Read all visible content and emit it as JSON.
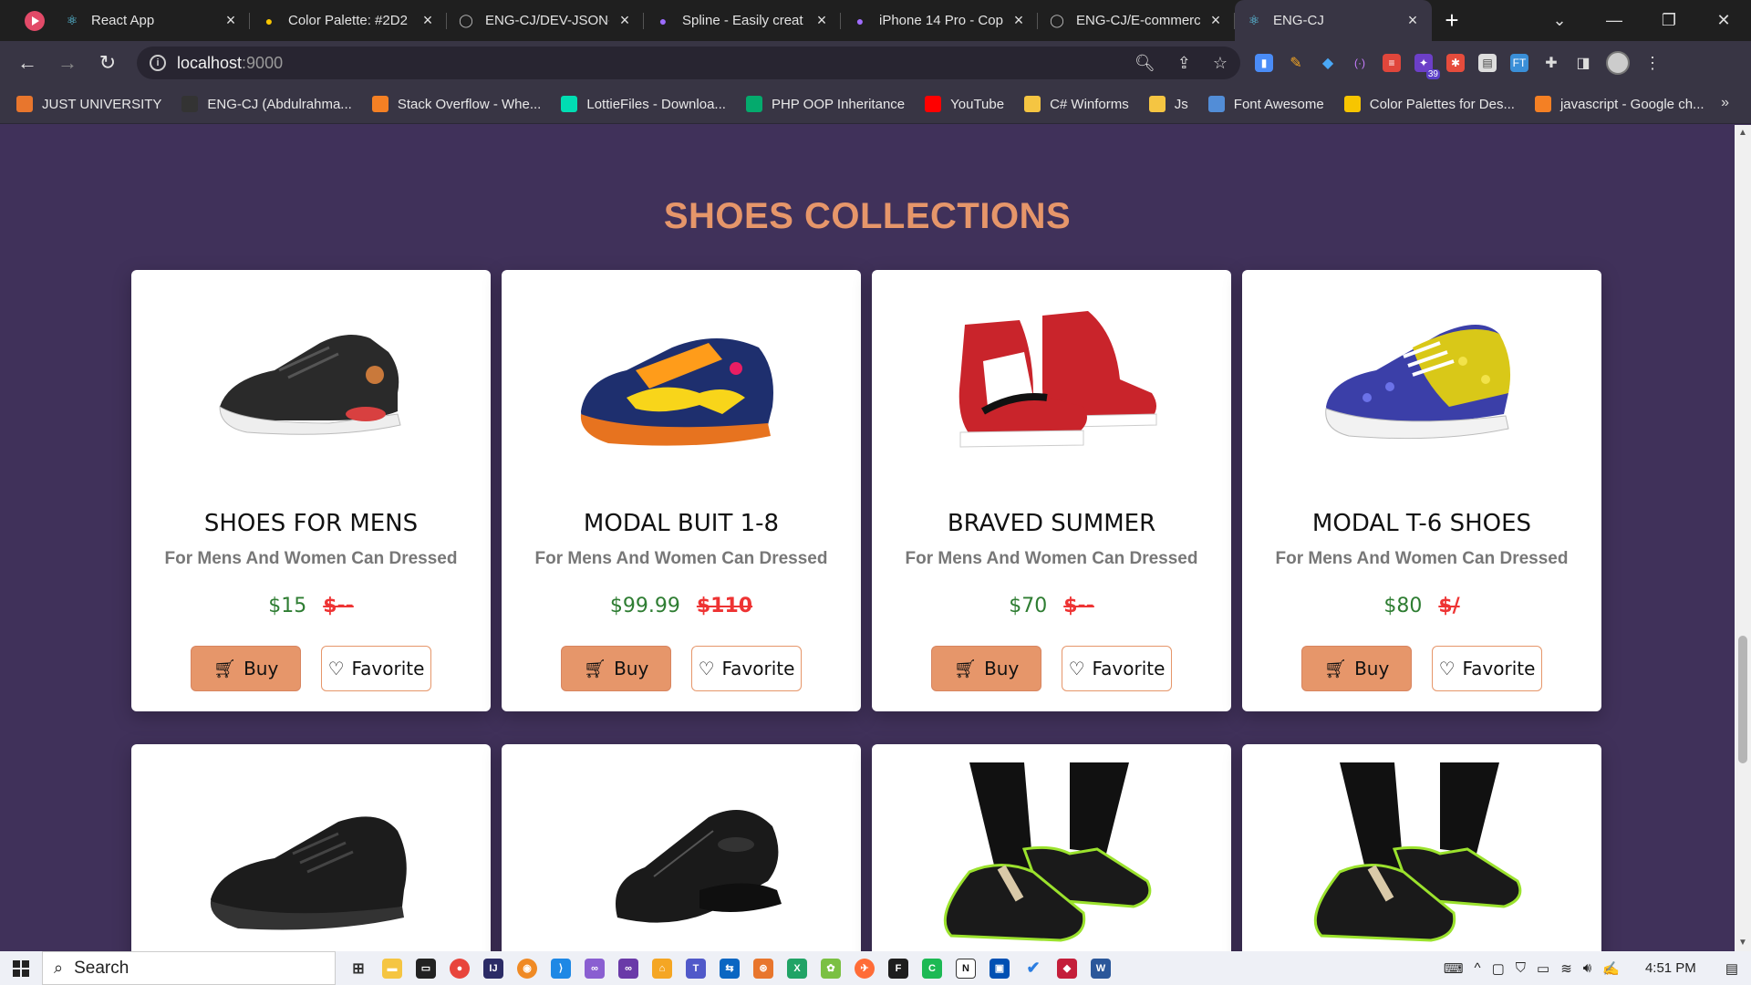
{
  "browser": {
    "tabs": [
      {
        "title": "React App",
        "favicon": "react-icon",
        "color": "#61dafb",
        "active": false
      },
      {
        "title": "Color Palette: #2D2",
        "favicon": "palette-icon",
        "color": "#f7c500",
        "active": false
      },
      {
        "title": "ENG-CJ/DEV-JSON-",
        "favicon": "github-icon",
        "color": "#bbbbbb",
        "active": false
      },
      {
        "title": "Spline - Easily creat",
        "favicon": "spline-icon",
        "color": "#9c6cff",
        "active": false
      },
      {
        "title": "iPhone 14 Pro - Cop",
        "favicon": "figma-icon",
        "color": "#a06cff",
        "active": false
      },
      {
        "title": "ENG-CJ/E-commerc",
        "favicon": "github-icon",
        "color": "#bbbbbb",
        "active": false
      },
      {
        "title": "ENG-CJ",
        "favicon": "react-icon",
        "color": "#61dafb",
        "active": true
      }
    ],
    "address": {
      "host": "localhost",
      "port": ":9000"
    },
    "bookmarks": [
      {
        "label": "JUST UNIVERSITY",
        "color": "#e8762d"
      },
      {
        "label": "ENG-CJ (Abdulrahma...",
        "color": "#333333"
      },
      {
        "label": "Stack Overflow - Whe...",
        "color": "#f48024"
      },
      {
        "label": "LottieFiles - Downloa...",
        "color": "#00ddb3"
      },
      {
        "label": "PHP OOP Inheritance",
        "color": "#04aa6d"
      },
      {
        "label": "YouTube",
        "color": "#ff0000"
      },
      {
        "label": "C# Winforms",
        "color": "#f5c542"
      },
      {
        "label": "Js",
        "color": "#f5c542"
      },
      {
        "label": "Font Awesome",
        "color": "#528dd7"
      },
      {
        "label": "Color Palettes for Des...",
        "color": "#f7c500"
      },
      {
        "label": "javascript - Google ch...",
        "color": "#f48024"
      }
    ],
    "extension_badge": "39"
  },
  "page": {
    "section_title": "SHOES COLLECTIONS",
    "buy_label": "Buy",
    "favorite_label": "Favorite",
    "products": [
      {
        "name": "SHOES FOR MENS",
        "subtitle": "For Mens And Women Can Dressed",
        "price": "$15",
        "old_price": "$--",
        "image": "black-running-shoe"
      },
      {
        "name": "MODAL BUIT 1-8",
        "subtitle": "For Mens And Women Can Dressed",
        "price": "$99.99",
        "old_price": "$110",
        "image": "kids-dinosaur-shoe"
      },
      {
        "name": "BRAVED SUMMER",
        "subtitle": "For Mens And Women Can Dressed",
        "price": "$70",
        "old_price": "$--",
        "image": "red-high-top-sneaker"
      },
      {
        "name": "MODAL T-6 SHOES",
        "subtitle": "For Mens And Women Can Dressed",
        "price": "$80",
        "old_price": "$/",
        "image": "floral-sneaker"
      }
    ],
    "products_row2_images": [
      "black-trainer",
      "leather-oxford-shoe",
      "black-green-sneaker-worn",
      "black-green-sneaker-worn"
    ]
  },
  "taskbar": {
    "search_label": "Search",
    "time": "4:51 PM"
  }
}
